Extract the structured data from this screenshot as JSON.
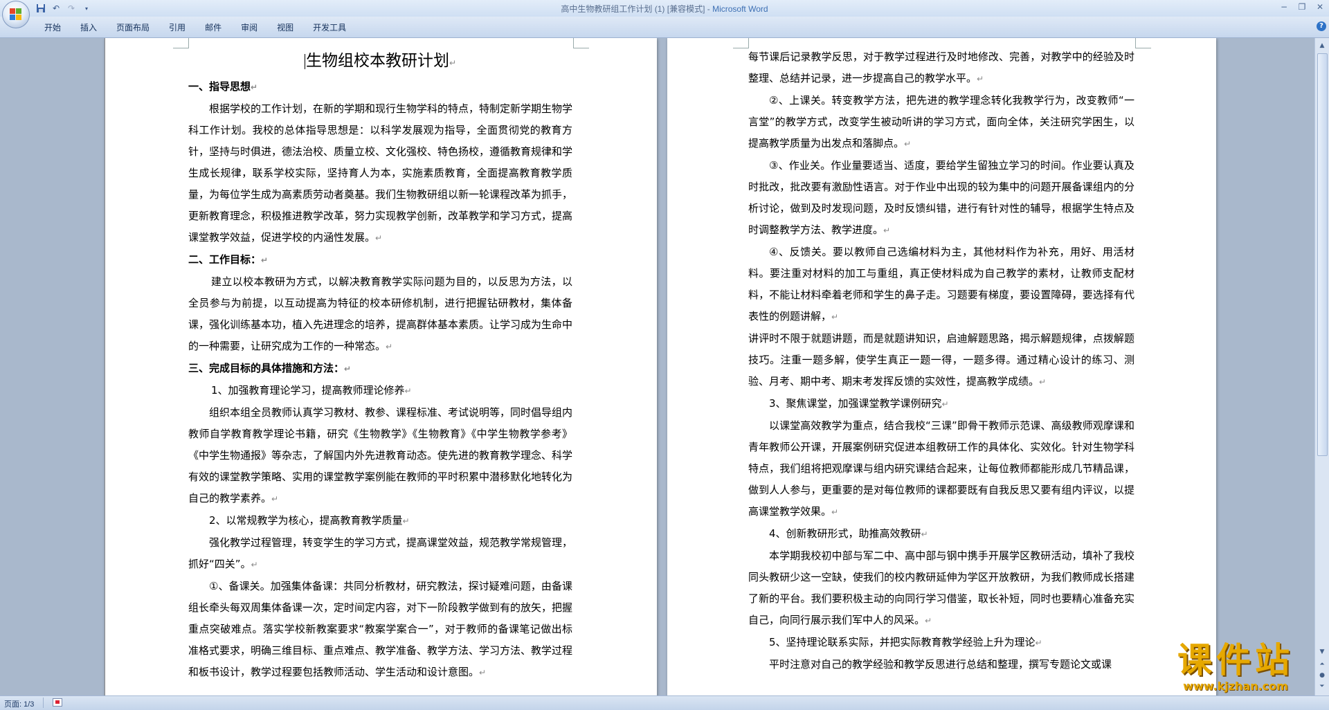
{
  "window": {
    "title": "高中生物教研组工作计划 (1) [兼容模式] - ",
    "app_name": "Microsoft Word"
  },
  "quick_access": {
    "save_icon": "save-icon",
    "undo_icon": "undo-icon",
    "redo_icon": "redo-icon",
    "customize_icon": "customize-qat-icon"
  },
  "ribbon": {
    "tabs": [
      "开始",
      "插入",
      "页面布局",
      "引用",
      "邮件",
      "审阅",
      "视图",
      "开发工具"
    ]
  },
  "document": {
    "title": "生物组校本教研计划",
    "page1": [
      "一、指导思想",
      "根据学校的工作计划，在新的学期和现行生物学科的特点，特制定新学期生物学科工作计划。我校的总体指导思想是：以科学发展观为指导，全面贯彻党的教育方针，坚持与时俱进，德法治校、质量立校、文化强校、特色扬校，遵循教育规律和学生成长规律，联系学校实际，坚持育人为本，实施素质教育，全面提高教育教学质量，为每位学生成为高素质劳动者奠基。我们生物教研组以新一轮课程改革为抓手，更新教育理念，积极推进教学改革，努力实现教学创新，改革教学和学习方式，提高课堂教学效益，促进学校的内涵性发展。",
      "二、工作目标：",
      "建立以校本教研为方式，以解决教育教学实际问题为目的，以反思为方法，以全员参与为前提，以互动提高为特征的校本研修机制，进行把握钻研教材，集体备课，强化训练基本功，植入先进理念的培养，提高群体基本素质。让学习成为生命中的一种需要，让研究成为工作的一种常态。",
      "三、完成目标的具体措施和方法：",
      "1、加强教育理论学习，提高教师理论修养",
      "组织本组全员教师认真学习教材、教参、课程标准、考试说明等，同时倡导组内教师自学教育教学理论书籍，研究《生物教学》《生物教育》《中学生物教学参考》《中学生物通报》等杂志，了解国内外先进教育动态。使先进的教育教学理念、科学有效的课堂教学策略、实用的课堂教学案例能在教师的平时积累中潜移默化地转化为自己的教学素养。",
      "2、以常规教学为核心，提高教育教学质量",
      "强化教学过程管理，转变学生的学习方式，提高课堂效益，规范教学常规管理，抓好“四关”。",
      "①、备课关。加强集体备课：共同分析教材，研究教法，探讨疑难问题，由备课组长牵头每双周集体备课一次，定时间定内容，对下一阶段教学做到有的放矢，把握重点突破难点。落实学校新教案要求“教案学案合一”，对于教师的备课笔记做出标准格式要求，明确三维目标、重点难点、教学准备、教学方法、学习方法、教学过程和板书设计，教学过程要包括教师活动、学生活动和设计意图。"
    ],
    "page2": [
      "每节课后记录教学反思，对于教学过程进行及时地修改、完善，对教学中的经验及时整理、总结并记录，进一步提高自己的教学水平。",
      "②、上课关。转变教学方法，把先进的教学理念转化我教学行为，改变教师“一言堂”的教学方式，改变学生被动听讲的学习方式，面向全体，关注研究学困生，以提高教学质量为出发点和落脚点。",
      "③、作业关。作业量要适当、适度，要给学生留独立学习的时间。作业要认真及时批改，批改要有激励性语言。对于作业中出现的较为集中的问题开展备课组内的分析讨论，做到及时发现问题，及时反馈纠错，进行有针对性的辅导，根据学生特点及时调整教学方法、教学进度。",
      "④、反馈关。要以教师自己选编材料为主，其他材料作为补充，用好、用活材料。要注重对材料的加工与重组，真正使材料成为自己教学的素材，让教师支配材料，不能让材料牵着老师和学生的鼻子走。习题要有梯度，要设置障碍，要选择有代表性的例题讲解，",
      "讲评时不限于就题讲题，而是就题讲知识，启迪解题思路，揭示解题规律，点拨解题技巧。注重一题多解，使学生真正一题一得，一题多得。通过精心设计的练习、测验、月考、期中考、期末考发挥反馈的实效性，提高教学成绩。",
      "3、聚焦课堂，加强课堂教学课例研究",
      "以课堂高效教学为重点，结合我校“三课”即骨干教师示范课、高级教师观摩课和青年教师公开课，开展案例研究促进本组教研工作的具体化、实效化。针对生物学科特点，我们组将把观摩课与组内研究课结合起来，让每位教师都能形成几节精品课，做到人人参与，更重要的是对每位教师的课都要既有自我反思又要有组内评议，以提高课堂教学效果。",
      "4、创新教研形式，助推高效教研",
      "本学期我校初中部与军二中、高中部与钢中携手开展学区教研活动，填补了我校同头教研少这一空缺，使我们的校内教研延伸为学区开放教研，为我们教师成长搭建了新的平台。我们要积极主动的向同行学习借鉴，取长补短，同时也要精心准备充实自己，向同行展示我们军中人的风采。",
      "5、坚持理论联系实际，并把实际教育教学经验上升为理论",
      "平时注意对自己的教学经验和教学反思进行总结和整理，撰写专题论文或课"
    ]
  },
  "statusbar": {
    "page_info": "页面: 1/3"
  },
  "watermark": {
    "title": "课件站",
    "url": "www.kjzhan.com"
  },
  "colors": {
    "workspace": "#a9b8cc",
    "ribbon": "#dbe6f4",
    "title_app": "#3d6fb3",
    "watermark": "#e6a800"
  }
}
